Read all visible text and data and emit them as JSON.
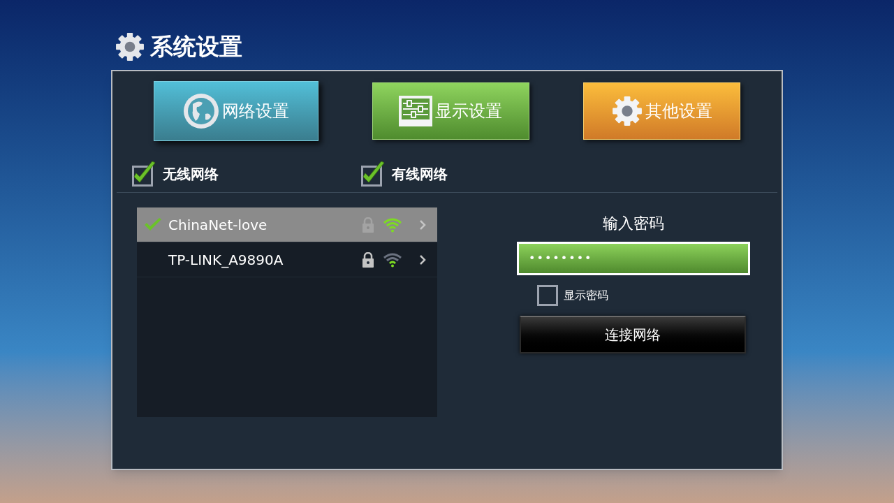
{
  "window": {
    "title": "系统设置"
  },
  "tabs": [
    {
      "label": "网络设置",
      "kind": "globe",
      "selected": true
    },
    {
      "label": "显示设置",
      "kind": "sliders",
      "selected": false
    },
    {
      "label": "其他设置",
      "kind": "gear",
      "selected": false
    }
  ],
  "network_types": [
    {
      "label": "无线网络",
      "checked": true
    },
    {
      "label": "有线网络",
      "checked": true
    }
  ],
  "networks": [
    {
      "name": "ChinaNet-love",
      "selected": true,
      "connected": true
    },
    {
      "name": "TP-LINK_A9890A",
      "selected": false,
      "connected": false
    }
  ],
  "password": {
    "title": "输入密码",
    "value": "••••••••",
    "show_label": "显示密码",
    "show_checked": false
  },
  "connect_button": "连接网络"
}
